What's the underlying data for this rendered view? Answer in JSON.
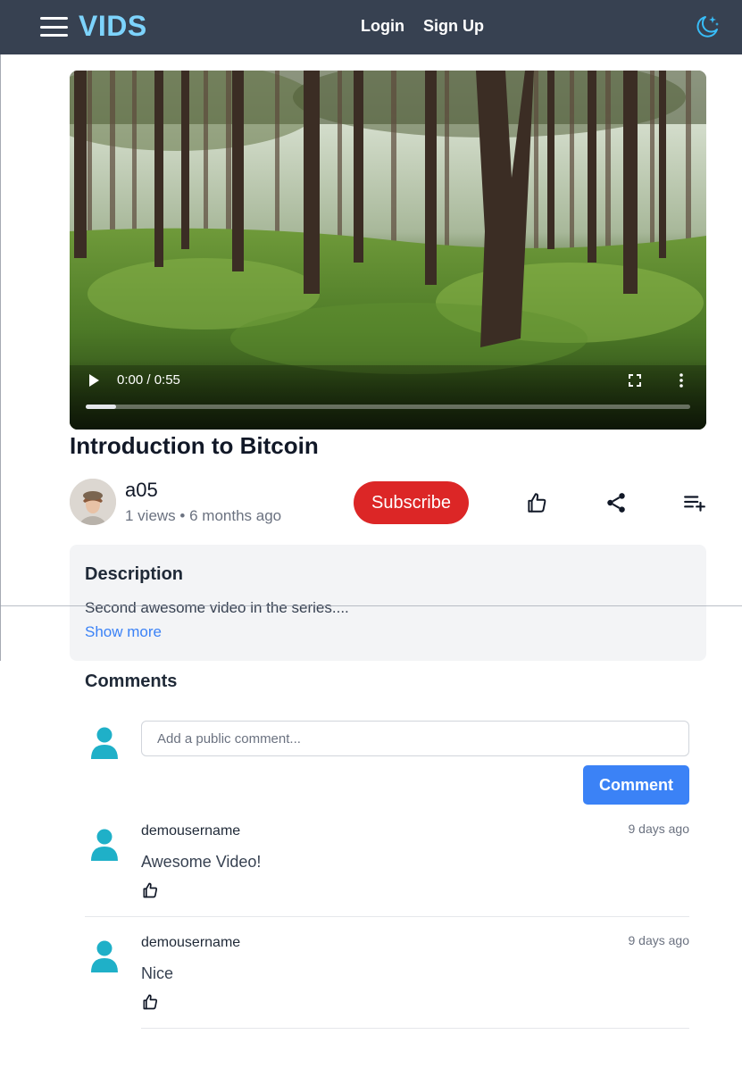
{
  "navbar": {
    "logo": "VIDS",
    "menu_icon": "hamburger-menu-icon",
    "login_label": "Login",
    "signup_label": "Sign Up",
    "theme_icon": "moon-stars-icon",
    "background": "#374151",
    "logo_color": "#7dd3fc"
  },
  "video": {
    "time": "0:00 / 0:55",
    "progress": 0.05,
    "play_icon": "play-icon",
    "fullscreen_icon": "fullscreen-icon",
    "more_icon": "more-vertical-icon"
  },
  "title": "Introduction to Bitcoin",
  "channel": {
    "name": "a05",
    "views": "1 views",
    "separator": "•",
    "age": "6 months ago",
    "subscribe_label": "Subscribe",
    "subscribe_color": "#dc2626"
  },
  "actions": {
    "like_icon": "thumbs-up-icon",
    "share_icon": "share-icon",
    "playlist_icon": "playlist-add-icon"
  },
  "description": {
    "heading": "Description",
    "text": "Second awesome video in the series....",
    "show_more": "Show more"
  },
  "comments": {
    "heading": "Comments",
    "input_placeholder": "Add a public comment...",
    "submit_label": "Comment",
    "submit_color": "#3b82f6",
    "user_icon_color": "#1fb0c8",
    "items": [
      {
        "user": "demousername",
        "time": "9 days ago",
        "text": "Awesome Video!"
      },
      {
        "user": "demousername",
        "time": "9 days ago",
        "text": "Nice"
      }
    ]
  }
}
